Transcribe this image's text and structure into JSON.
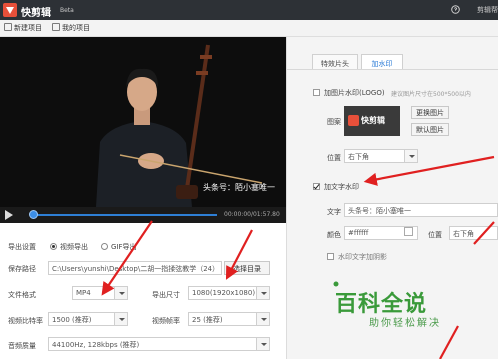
{
  "app": {
    "name": "快剪辑",
    "badge": "Beta",
    "help": "剪辑帮"
  },
  "toolbar": {
    "new_project": "新建项目",
    "my_projects": "我的项目"
  },
  "player": {
    "watermark_text": "头条号：陌小塞唯一",
    "time": "00:00:00/01:57.80"
  },
  "export": {
    "settings_label": "导出设置",
    "video_export": "视频导出",
    "gif_export": "GIF导出",
    "save_path_label": "保存路径",
    "save_path_value": "C:\\Users\\yunshi\\Desktop\\二胡一指揉弦教学（24）",
    "choose_dir": "选择目录",
    "format_label": "文件格式",
    "format_value": "MP4",
    "size_label": "导出尺寸",
    "size_value": "1080(1920x1080)",
    "vbitrate_label": "视频比特率",
    "vbitrate_value": "1500 (推荐)",
    "framerate_label": "视频帧率",
    "framerate_value": "25 (推荐)",
    "audio_label": "音频质量",
    "audio_value": "44100Hz, 128kbps (推荐)"
  },
  "right_panel": {
    "tabs": [
      {
        "label": "特效片头"
      },
      {
        "label": "加水印",
        "active": true
      }
    ],
    "image_watermark": "加图片水印(LOGO)",
    "image_hint": "建议图片尺寸在500*500以内",
    "pattern_label": "图案",
    "logo_preview_text": "快剪辑",
    "change_image": "更换图片",
    "default_image": "默认图片",
    "position_label": "位置",
    "position_value": "右下角",
    "text_watermark": "加文字水印",
    "text_label": "文字",
    "text_value": "头条号：陌小塞唯一",
    "color_label": "颜色",
    "color_value": "#ffffff",
    "text_position_label": "位置",
    "text_position_value": "右下角",
    "shadow_label": "水印文字加阴影"
  },
  "brand": {
    "line1": "百科全说",
    "line2": "助你轻松解决"
  },
  "colors": {
    "titlebar": "#2d3136",
    "accent": "#2b7bd6",
    "arrow": "#e02020",
    "brand": "#3a9a3a"
  },
  "icons": [
    "app-logo-icon",
    "folder-icon",
    "play-icon",
    "help-icon"
  ]
}
